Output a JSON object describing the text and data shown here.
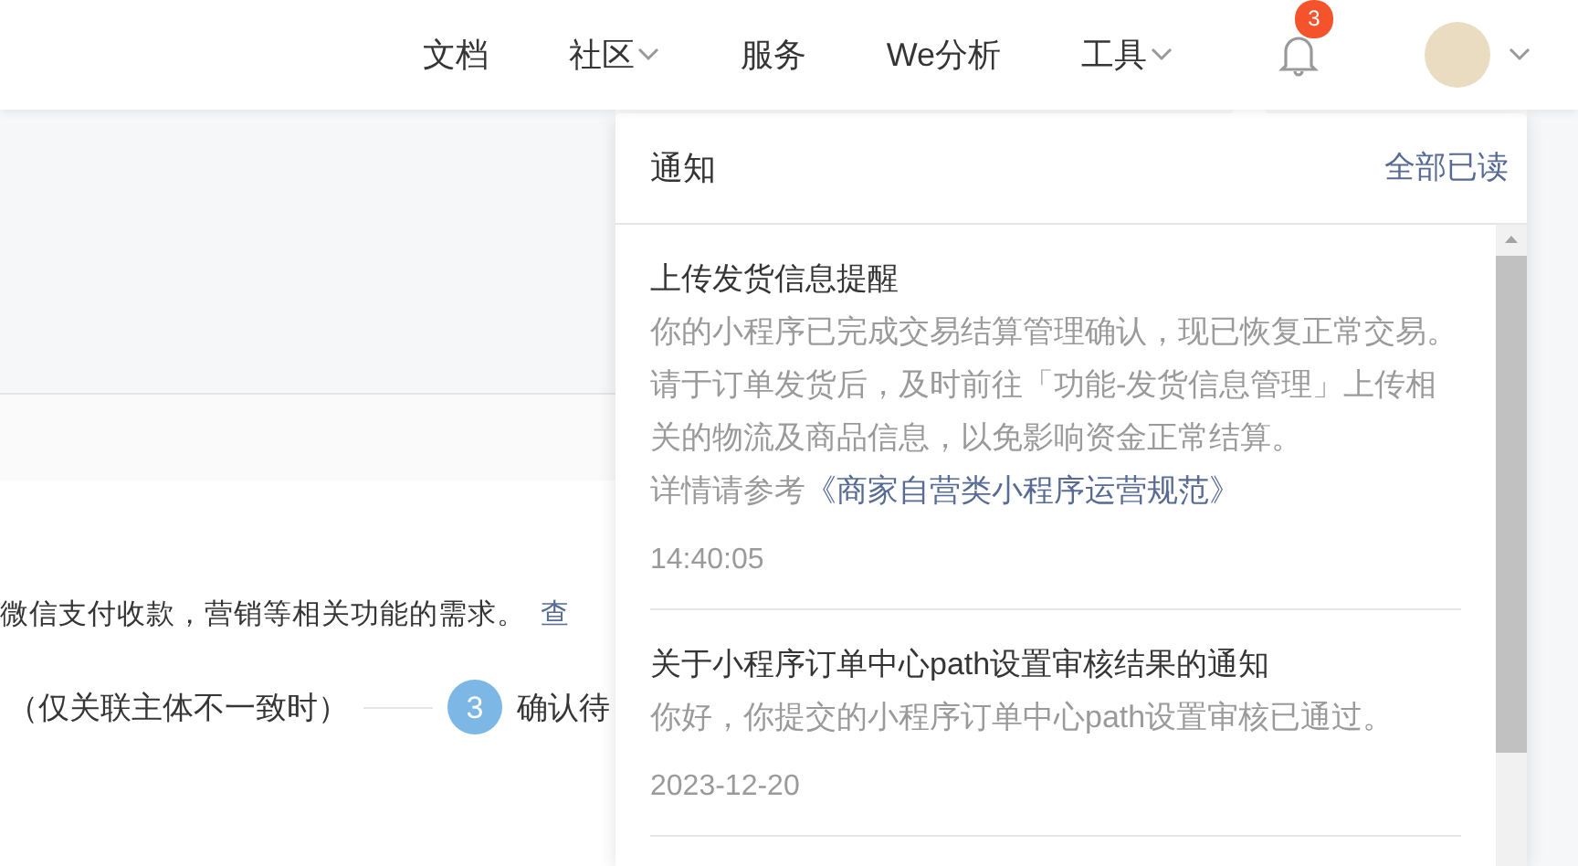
{
  "nav": {
    "items": [
      {
        "label": "文档",
        "dropdown": false
      },
      {
        "label": "社区",
        "dropdown": true
      },
      {
        "label": "服务",
        "dropdown": false
      },
      {
        "label": "We分析",
        "dropdown": false
      },
      {
        "label": "工具",
        "dropdown": true
      }
    ],
    "notifications": {
      "badge": "3"
    },
    "account": {
      "dropdown": true
    }
  },
  "background_page": {
    "description": "微信支付收款，营销等相关功能的需求。",
    "link": "查",
    "steps": [
      {
        "label": "（仅关联主体不一致时）"
      },
      {
        "number": "3",
        "label": "确认待"
      }
    ]
  },
  "notification_panel": {
    "title": "通知",
    "mark_all_read": "全部已读",
    "items": [
      {
        "title": "上传发货信息提醒",
        "body": "你的小程序已完成交易结算管理确认，现已恢复正常交易。请于订单发货后，及时前往「功能-发货信息管理」上传相关的物流及商品信息，以免影响资金正常结算。",
        "detail_prefix": "详情请参考",
        "detail_link": "《商家自营类小程序运营规范》",
        "time": "14:40:05"
      },
      {
        "title": "关于小程序订单中心path设置审核结果的通知",
        "body": "你好，你提交的小程序订单中心path设置审核已通过。",
        "time": "2023-12-20"
      }
    ]
  }
}
